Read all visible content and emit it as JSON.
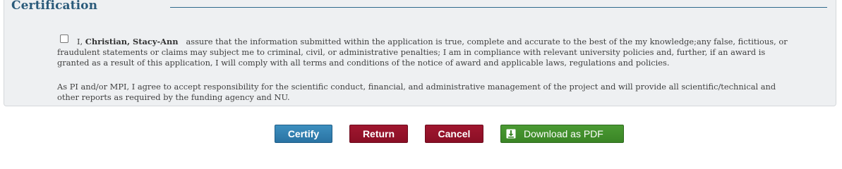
{
  "certification": {
    "title": "Certification",
    "checked": false,
    "name": "Christian, Stacy-Ann",
    "statement_prefix": "I,",
    "statement_body": "assure that the information submitted within the application is true, complete and accurate to the best of the my knowledge;any false, fictitious, or fraudulent statements or claims may subject me to criminal, civil, or administrative penalties; I am in compliance with relevant university policies and, further, if an award is granted as a result of this application, I will comply with all terms and conditions of the notice of award and applicable laws, regulations and policies.",
    "responsibility": "As PI and/or MPI, I agree to accept responsibility for the scientific conduct, financial, and administrative management of the project and will provide all scientific/technical and other reports as required by the funding agency and NU."
  },
  "buttons": {
    "certify": "Certify",
    "return": "Return",
    "cancel": "Cancel",
    "download": "Download as PDF",
    "download_icon": "download-icon"
  },
  "colors": {
    "title": "#2a5a7a",
    "certify": "#2a73a3",
    "return": "#8a0f25",
    "cancel": "#8a0f25",
    "download": "#3a8526"
  }
}
